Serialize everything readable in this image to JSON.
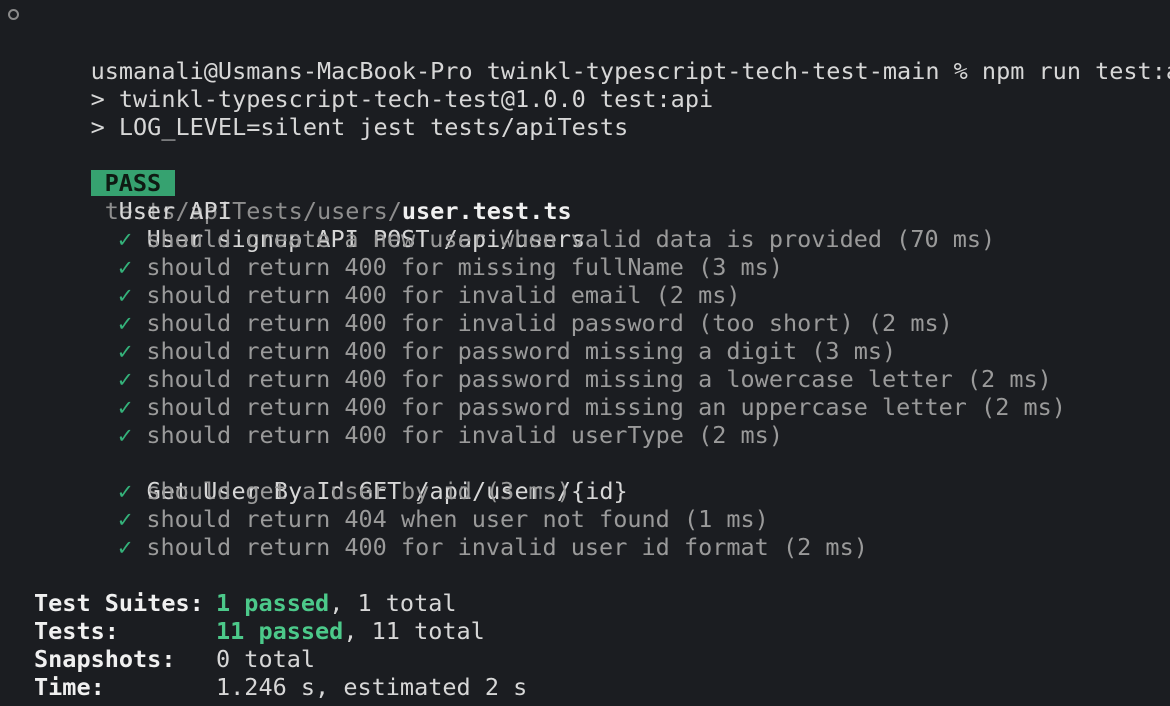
{
  "prompt": {
    "text": "usmanali@Usmans-MacBook-Pro twinkl-typescript-tech-test-main % npm run test:api"
  },
  "script_lines": [
    "> twinkl-typescript-tech-test@1.0.0 test:api",
    "> LOG_LEVEL=silent jest tests/apiTests"
  ],
  "result": {
    "badge": "PASS",
    "path_dir": "tests/apiTests/users/",
    "path_file": "user.test.ts",
    "suite_name": "User API"
  },
  "groups": [
    {
      "title": "User signup API POST /api/users",
      "tests": [
        "should create a new user when valid data is provided (70 ms)",
        "should return 400 for missing fullName (3 ms)",
        "should return 400 for invalid email (2 ms)",
        "should return 400 for invalid password (too short) (2 ms)",
        "should return 400 for password missing a digit (3 ms)",
        "should return 400 for password missing a lowercase letter (2 ms)",
        "should return 400 for password missing an uppercase letter (2 ms)",
        "should return 400 for invalid userType (2 ms)"
      ]
    },
    {
      "title": "Get User By Id GET /api/users/{id}",
      "tests": [
        "should get a user by id (3 ms)",
        "should return 404 when user not found (1 ms)",
        "should return 400 for invalid user id format (2 ms)"
      ]
    }
  ],
  "check_glyph": "✓",
  "summary": {
    "suites": {
      "label": "Test Suites:",
      "passed": "1 passed",
      "rest": ", 1 total"
    },
    "tests": {
      "label": "Tests:",
      "passed": "11 passed",
      "rest": ", 11 total"
    },
    "snapshots": {
      "label": "Snapshots:",
      "value": "0 total"
    },
    "time": {
      "label": "Time:",
      "value": "1.246 s, estimated 2 s"
    }
  },
  "colors": {
    "background": "#1b1d21",
    "pass_badge": "#36a270",
    "check": "#34b27a",
    "passed_text": "#4cc98a"
  }
}
